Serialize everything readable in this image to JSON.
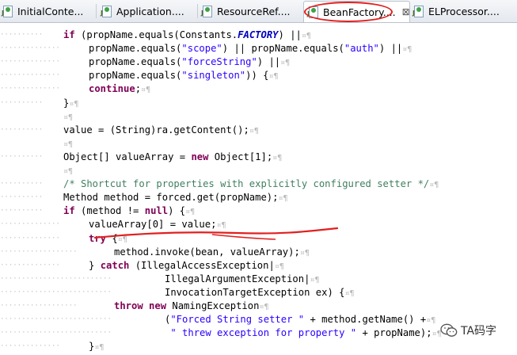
{
  "tabs": [
    {
      "label": "InitialConte...",
      "active": false
    },
    {
      "label": "Application....",
      "active": false
    },
    {
      "label": "ResourceRef....",
      "active": false
    },
    {
      "label": "BeanFactory....",
      "active": true
    },
    {
      "label": "ELProcessor....",
      "active": false
    }
  ],
  "tab_icon": "java-class-file-icon",
  "close_icon_label": "⊠",
  "code_lines": [
    {
      "indent": 4,
      "html": "<span class=\"kw\">if</span> (propName.equals(Constants.<span class=\"const\">FACTORY</span>) ||<span class=\"pil\">¤¶</span>"
    },
    {
      "indent": 6,
      "html": "propName.equals(<span class=\"str\">\"scope\"</span>) || propName.equals(<span class=\"str\">\"auth\"</span>) ||<span class=\"pil\">¤¶</span>"
    },
    {
      "indent": 6,
      "html": "propName.equals(<span class=\"str\">\"forceString\"</span>) ||<span class=\"pil\">¤¶</span>"
    },
    {
      "indent": 6,
      "html": "propName.equals(<span class=\"str\">\"singleton\"</span>)) {<span class=\"pil\">¤¶</span>"
    },
    {
      "indent": 6,
      "html": "<span class=\"kw\">continue</span>;<span class=\"pil\">¤¶</span>"
    },
    {
      "indent": 4,
      "html": "}<span class=\"pil\">¤¶</span>"
    },
    {
      "indent": 0,
      "html": "<span class=\"pil\">¤¶</span>"
    },
    {
      "indent": 4,
      "html": "value = (String)ra.getContent();<span class=\"pil\">¤¶</span>"
    },
    {
      "indent": 0,
      "html": "<span class=\"pil\">¤¶</span>"
    },
    {
      "indent": 4,
      "html": "Object[] valueArray = <span class=\"kw\">new</span> Object[1];<span class=\"pil\">¤¶</span>"
    },
    {
      "indent": 0,
      "html": "<span class=\"pil\">¤¶</span>"
    },
    {
      "indent": 4,
      "html": "<span class=\"cmt\">/* Shortcut for properties with explicitly configured setter */</span><span class=\"pil\">¤¶</span>"
    },
    {
      "indent": 4,
      "html": "Method method = forced.get(propName);<span class=\"pil\">¤¶</span>"
    },
    {
      "indent": 4,
      "html": "<span class=\"kw\">if</span> (method != <span class=\"kw\">null</span>) {<span class=\"pil\">¤¶</span>"
    },
    {
      "indent": 6,
      "html": "valueArray[0] = value;<span class=\"pil\">¤¶</span>"
    },
    {
      "indent": 6,
      "html": "<span class=\"kw\">try</span> {<span class=\"pil\">¤¶</span>"
    },
    {
      "indent": 8,
      "html": "method.invoke(bean, valueArray);<span class=\"pil\">¤¶</span>"
    },
    {
      "indent": 6,
      "html": "} <span class=\"kw\">catch</span> (IllegalAccessException|<span class=\"pil\">¤¶</span>"
    },
    {
      "indent": 12,
      "html": "IllegalArgumentException|<span class=\"pil\">¤¶</span>"
    },
    {
      "indent": 12,
      "html": "InvocationTargetException ex) {<span class=\"pil\">¤¶</span>"
    },
    {
      "indent": 8,
      "html": "<span class=\"kw\">throw</span> <span class=\"kw\">new</span> NamingException<span class=\"pil\">¤¶</span>"
    },
    {
      "indent": 12,
      "html": "(<span class=\"str\">\"Forced String setter \"</span> + method.getName() +<span class=\"pil\">¤¶</span>"
    },
    {
      "indent": 12,
      "html": " <span class=\"str\">\" threw exception for property \"</span> + propName);<span class=\"pil\">¤¶</span>"
    },
    {
      "indent": 6,
      "html": "}<span class=\"pil\">¤¶</span>"
    }
  ],
  "watermark": {
    "label": "TA码字",
    "icon": "wechat-icon"
  },
  "annotation_color": "#e0201f"
}
